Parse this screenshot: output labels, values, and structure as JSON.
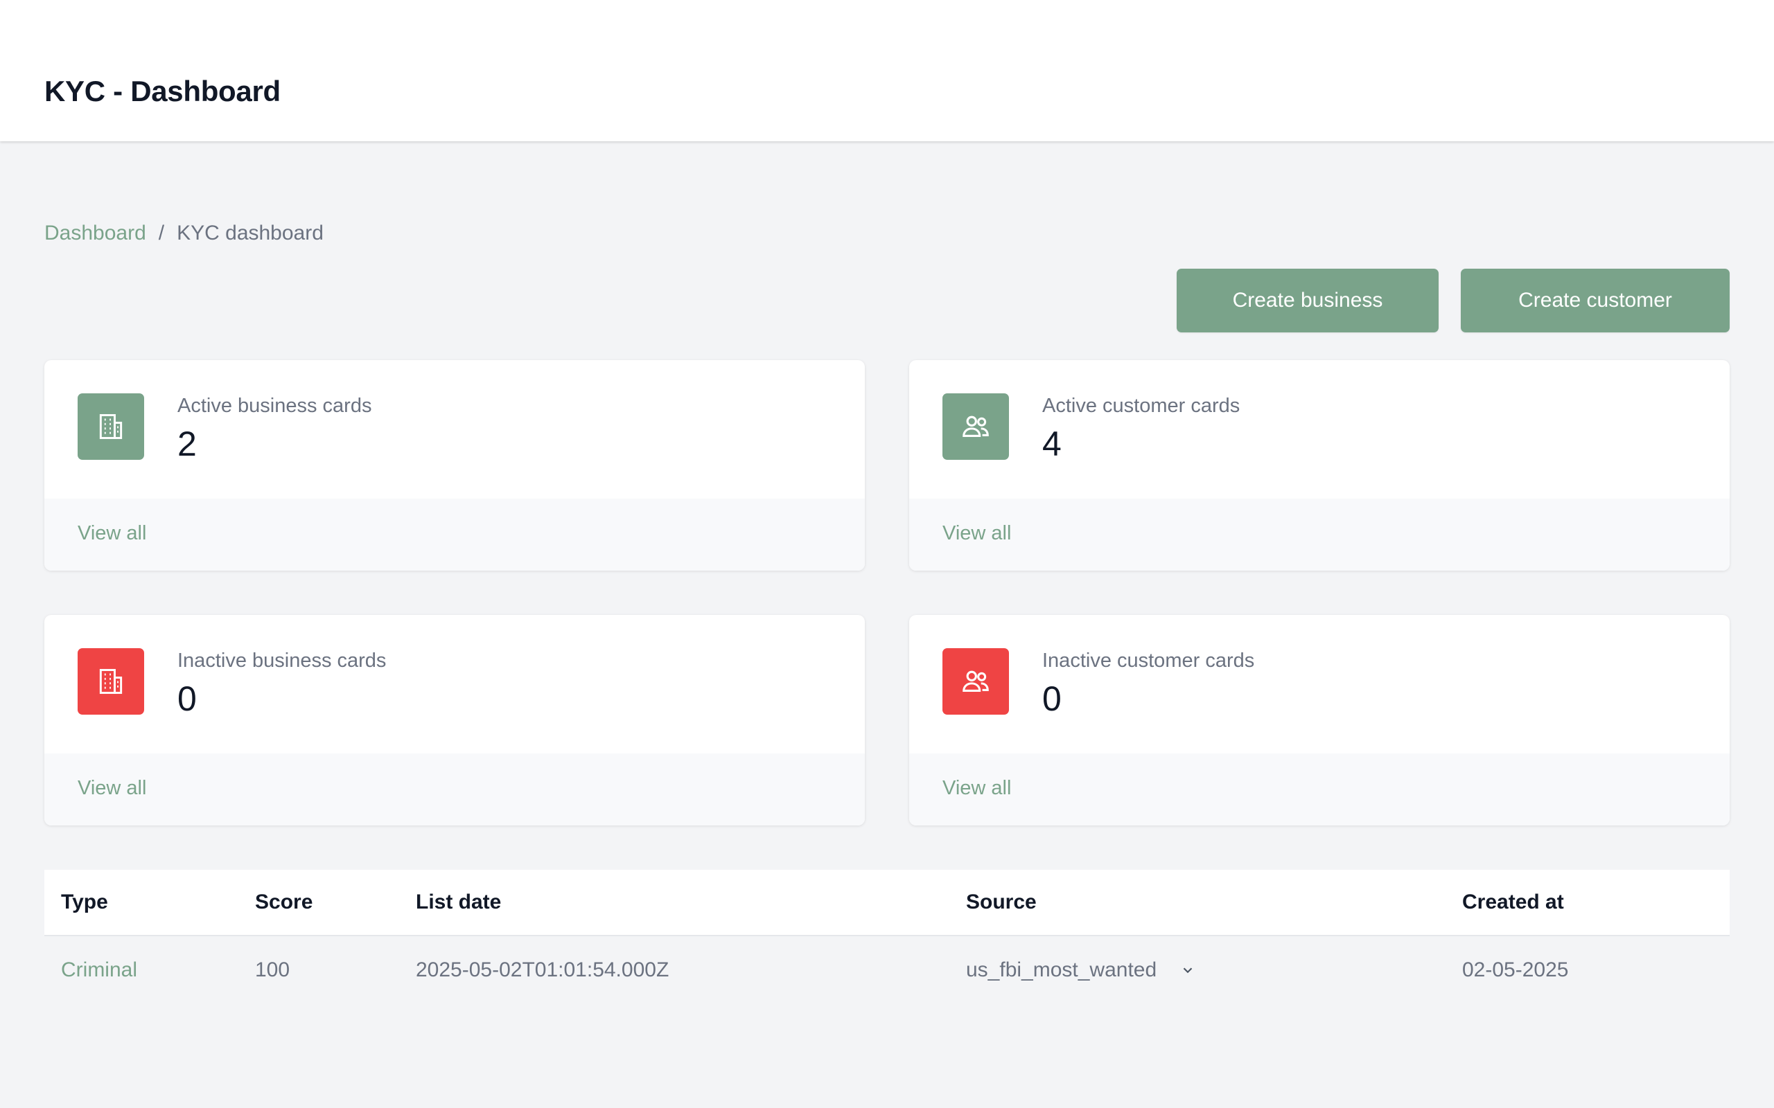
{
  "header": {
    "title": "KYC - Dashboard"
  },
  "breadcrumb": {
    "root": "Dashboard",
    "separator": "/",
    "current": "KYC dashboard"
  },
  "actions": {
    "create_business": "Create business",
    "create_customer": "Create customer"
  },
  "cards": [
    {
      "label": "Active business cards",
      "count": "2",
      "link": "View all",
      "icon": "building-icon",
      "color": "#7aa38a"
    },
    {
      "label": "Active customer cards",
      "count": "4",
      "link": "View all",
      "icon": "users-icon",
      "color": "#7aa38a"
    },
    {
      "label": "Inactive business cards",
      "count": "0",
      "link": "View all",
      "icon": "building-icon",
      "color": "#ef4444"
    },
    {
      "label": "Inactive customer cards",
      "count": "0",
      "link": "View all",
      "icon": "users-icon",
      "color": "#ef4444"
    }
  ],
  "table": {
    "columns": [
      "Type",
      "Score",
      "List date",
      "Source",
      "Created at"
    ],
    "rows": [
      {
        "type": "Criminal",
        "score": "100",
        "list_date": "2025-05-02T01:01:54.000Z",
        "source": "us_fbi_most_wanted",
        "created_at": "02-05-2025"
      }
    ]
  },
  "colors": {
    "accent": "#7aa38a",
    "danger": "#ef4444",
    "background": "#f3f4f6"
  }
}
